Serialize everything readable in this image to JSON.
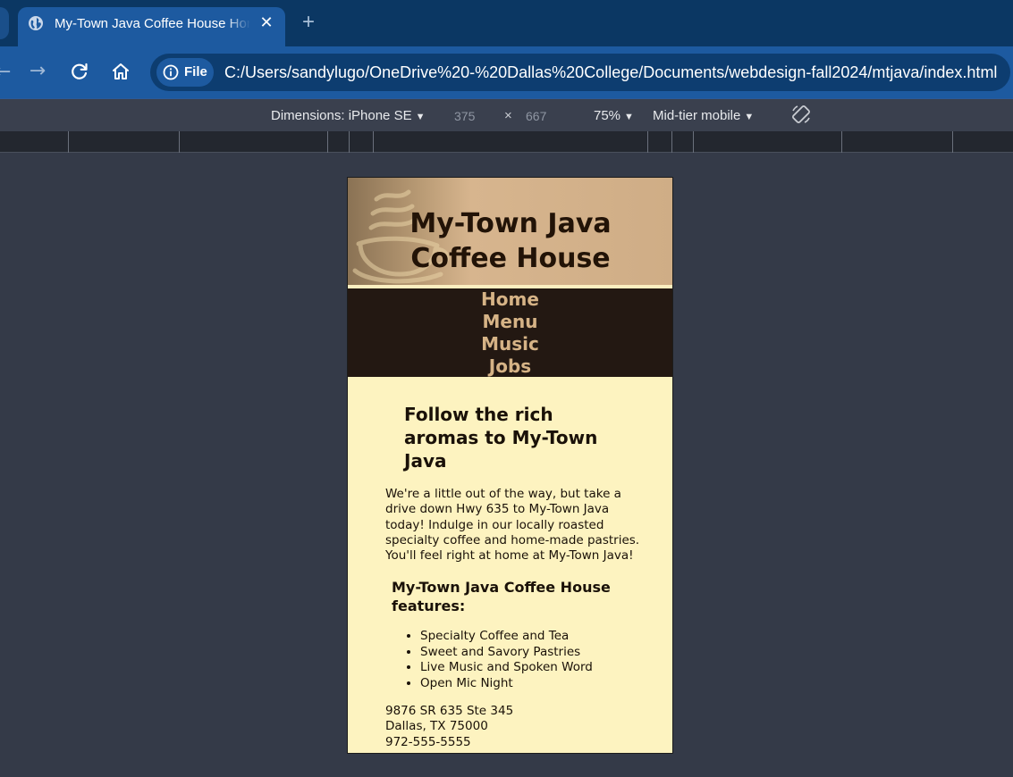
{
  "browser": {
    "tab": {
      "title": "My-Town Java Coffee House Home"
    },
    "new_tab_symbol": "+",
    "close_symbol": "✕",
    "address_bar": {
      "chip_label": "File",
      "url": "C:/Users/sandylugo/OneDrive%20-%20Dallas%20College/Documents/webdesign-fall2024/mtjava/index.html"
    }
  },
  "devtools": {
    "device_label": "Dimensions: iPhone SE",
    "width": "375",
    "times": "×",
    "height": "667",
    "zoom": "75%",
    "throttling": "Mid-tier mobile"
  },
  "site": {
    "title_line1": "My-Town Java",
    "title_line2": "Coffee House",
    "nav": [
      "Home",
      "Menu",
      "Music",
      "Jobs"
    ],
    "headline_line1": "Follow the rich",
    "headline_line2": "aromas to My-Town",
    "headline_line3": "Java",
    "intro_lines": [
      "We're a little out of the way, but take a",
      "drive down Hwy 635 to My-Town Java",
      "today! Indulge in our locally roasted",
      "specialty coffee and home-made pastries.",
      "You'll feel right at home at My-Town Java!"
    ],
    "features_heading_line1": "My-Town Java Coffee House",
    "features_heading_line2": "features:",
    "features": [
      "Specialty Coffee and Tea",
      "Sweet and Savory Pastries",
      "Live Music and Spoken Word",
      "Open Mic Night"
    ],
    "address": [
      "9876 SR 635 Ste 345",
      "Dallas, TX 75000",
      "972-555-5555"
    ]
  }
}
